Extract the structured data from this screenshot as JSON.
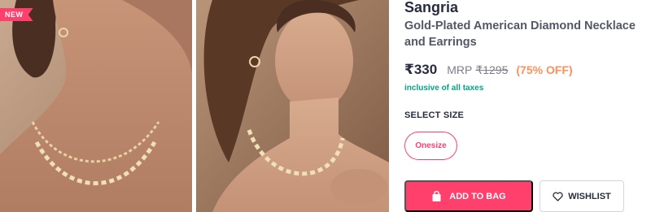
{
  "gallery": {
    "badge": "NEW",
    "images": [
      {
        "subject": "model-wearing-gold-necklace-side-view"
      },
      {
        "subject": "model-wearing-necklace-and-earrings-front-view"
      }
    ]
  },
  "product": {
    "brand": "Sangria",
    "name": "Gold-Plated American Diamond Necklace and Earrings"
  },
  "pricing": {
    "price": "₹330",
    "mrp_label": "MRP",
    "mrp": "₹1295",
    "discount": "(75% OFF)",
    "tax_note": "inclusive of all taxes"
  },
  "size": {
    "heading": "SELECT SIZE",
    "options": [
      "Onesize"
    ]
  },
  "actions": {
    "add_to_bag": "ADD TO BAG",
    "wishlist": "WISHLIST"
  },
  "colors": {
    "accent": "#ff3f6c",
    "discount": "#ff905a",
    "tax": "#03a685",
    "text": "#282c3f"
  },
  "icons": {
    "add_to_bag": "shopping-bag-icon",
    "wishlist": "heart-icon"
  }
}
